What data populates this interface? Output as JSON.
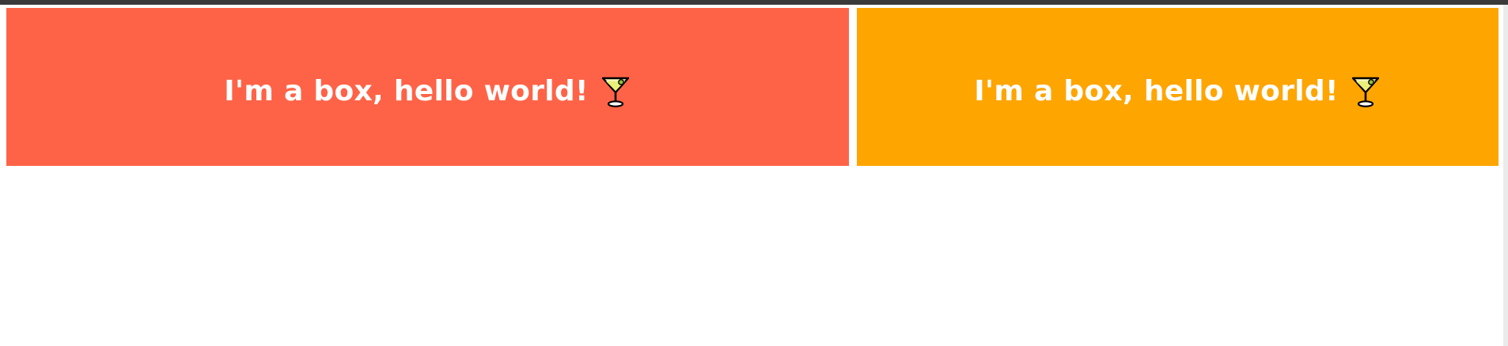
{
  "boxes": [
    {
      "label": "I'm a box, hello world!",
      "color": "#ff6347",
      "icon": "cocktail-glass-icon"
    },
    {
      "label": "I'm a box, hello world!",
      "color": "#ffa500",
      "icon": "cocktail-glass-icon"
    }
  ],
  "colors": {
    "background": "#ffffff",
    "text": "#ffffff",
    "top_bar": "#3a3a3a"
  }
}
